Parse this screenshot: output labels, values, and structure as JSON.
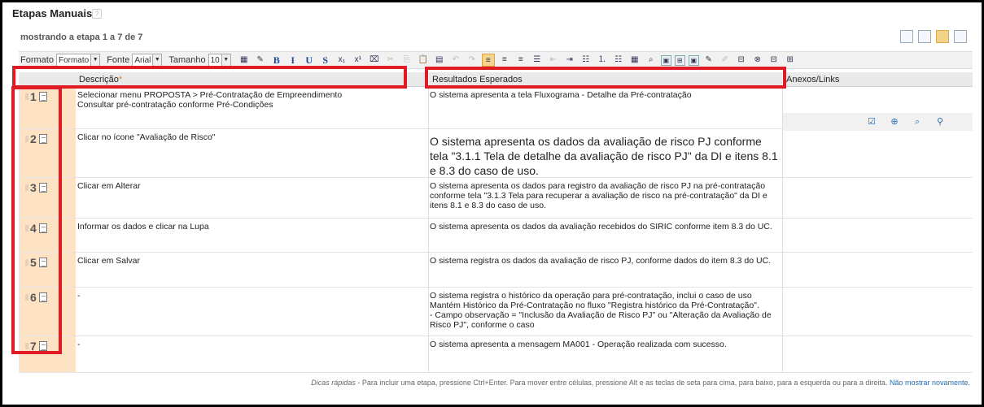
{
  "header": {
    "title": "Etapas Manuais",
    "pager": "mostrando a etapa 1 a 7 de 7"
  },
  "toolbar": {
    "format_label": "Formato",
    "format_value": "Formato",
    "font_label": "Fonte",
    "font_value": "Arial",
    "size_label": "Tamanho",
    "size_value": "10"
  },
  "columns": {
    "description": "Descrição",
    "results": "Resultados Esperados",
    "attachments": "Anexos/Links"
  },
  "steps": [
    {
      "num": "1",
      "description": "Selecionar menu PROPOSTA > Pré-Contratação de Empreendimento\nConsultar pré-contratação conforme Pré-Condições",
      "result": "O sistema apresenta a tela Fluxograma - Detalhe da Pré-contratação"
    },
    {
      "num": "2",
      "description": "Clicar no ícone \"Avaliação de Risco\"",
      "result": "O sistema apresenta os dados da avaliação de risco PJ conforme tela \"3.1.1 Tela de detalhe da avaliação de risco PJ\" da DI e itens 8.1 e 8.3 do caso de uso."
    },
    {
      "num": "3",
      "description": "Clicar em Alterar",
      "result": "O sistema apresenta os dados para registro da avaliação de risco PJ na pré-contratação conforme tela \"3.1.3 Tela para recuperar a avaliação de risco na pré-contratação\" da DI e itens 8.1 e 8.3 do caso de uso."
    },
    {
      "num": "4",
      "description": "Informar os dados e clicar na Lupa",
      "result": "O sistema apresenta os dados da avaliação recebidos do SIRIC conforme item 8.3 do UC."
    },
    {
      "num": "5",
      "description": "Clicar em Salvar",
      "result": "O sistema registra os dados da avaliação de risco PJ, conforme dados do item 8.3 do UC."
    },
    {
      "num": "6",
      "description": "-",
      "result": "O sistema registra o histórico da operação para pré-contratação, inclui o caso de uso Mantém Histórico da Pré-Contratação no fluxo \"Registra histórico da Pré-Contratação\".\n - Campo observação = \"Inclusão da Avaliação de Risco PJ\" ou \"Alteração da Avaliação de Risco PJ\", conforme o caso"
    },
    {
      "num": "7",
      "description": "-",
      "result": "O sistema apresenta a mensagem MA001 - Operação realizada com sucesso."
    }
  ],
  "tips": {
    "label": "Dicas rápidas",
    "text": " - Para incluir uma etapa, pressione Ctrl+Enter. Para mover entre células, pressione Alt e as teclas de seta para cima, para baixo, para a esquerda ou para a direita.",
    "dismiss": "Não mostrar novamente."
  },
  "colors": {
    "highlight": "#e01b24",
    "step_column": "#fde3c4",
    "link": "#2a6ab0"
  }
}
